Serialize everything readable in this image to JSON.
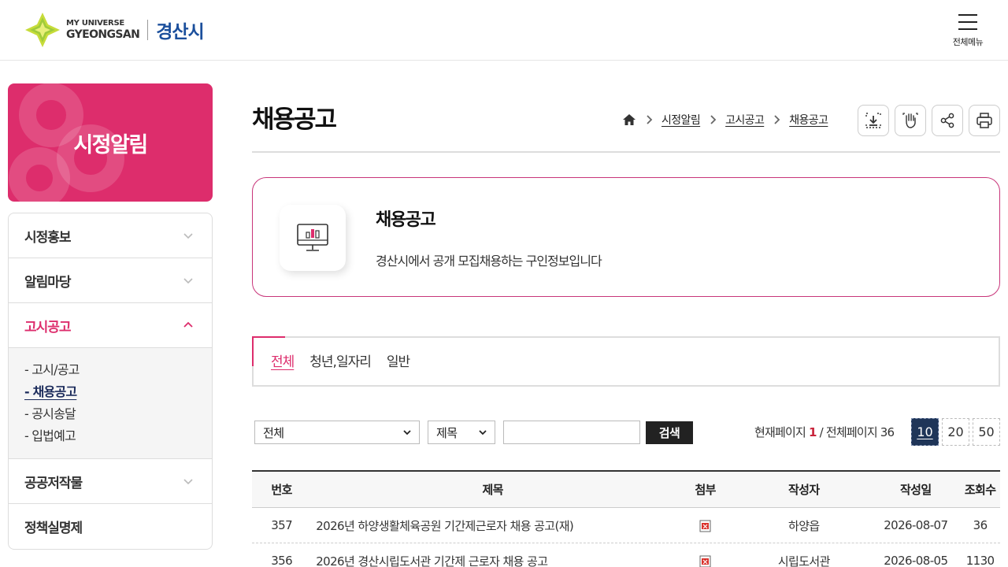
{
  "header": {
    "logo_line1": "MY UNIVERSE",
    "logo_line2": "GYEONGSAN",
    "logo_city": "경산시",
    "allmenu_label": "전체메뉴"
  },
  "sidebar": {
    "title": "시정알림",
    "items": [
      {
        "label": "시정홍보",
        "icon": "chevron-down-icon"
      },
      {
        "label": "알림마당",
        "icon": "chevron-down-icon"
      },
      {
        "label": "고시공고",
        "icon": "chevron-up-icon"
      },
      {
        "label": "공공저작물",
        "icon": "chevron-down-icon"
      },
      {
        "label": "정책실명제"
      }
    ],
    "sub_items": [
      "- 고시/공고",
      "- 채용공고",
      "- 공시송달",
      "- 입법예고"
    ]
  },
  "page": {
    "title": "채용공고",
    "breadcrumb": [
      "시정알림",
      "고시공고",
      "채용공고"
    ]
  },
  "info": {
    "title": "채용공고",
    "desc": "경산시에서 공개 모집채용하는 구인정보입니다"
  },
  "tabs": [
    "전체",
    "청년,일자리",
    "일반"
  ],
  "search": {
    "category_value": "전체",
    "field_value": "제목",
    "query": "",
    "button": "검색"
  },
  "paging": {
    "prefix": "현재페이지",
    "current": "1",
    "mid": "/ 전체페이지",
    "total": "36",
    "sizes": [
      "10",
      "20",
      "50"
    ]
  },
  "table": {
    "headers": [
      "번호",
      "제목",
      "첨부",
      "작성자",
      "작성일",
      "조회수"
    ],
    "rows": [
      {
        "no": "357",
        "title": "2026년 하양생활체육공원 기간제근로자 채용 공고(재)",
        "author": "하양읍",
        "date": "2026-08-07",
        "views": "36"
      },
      {
        "no": "356",
        "title": "2026년 경산시립도서관 기간제 근로자 채용 공고",
        "author": "시립도서관",
        "date": "2026-08-05",
        "views": "1130"
      }
    ]
  },
  "colors": {
    "accent": "#dd2d6c",
    "navy": "#1f3558",
    "city_blue": "#1b4f9c"
  }
}
